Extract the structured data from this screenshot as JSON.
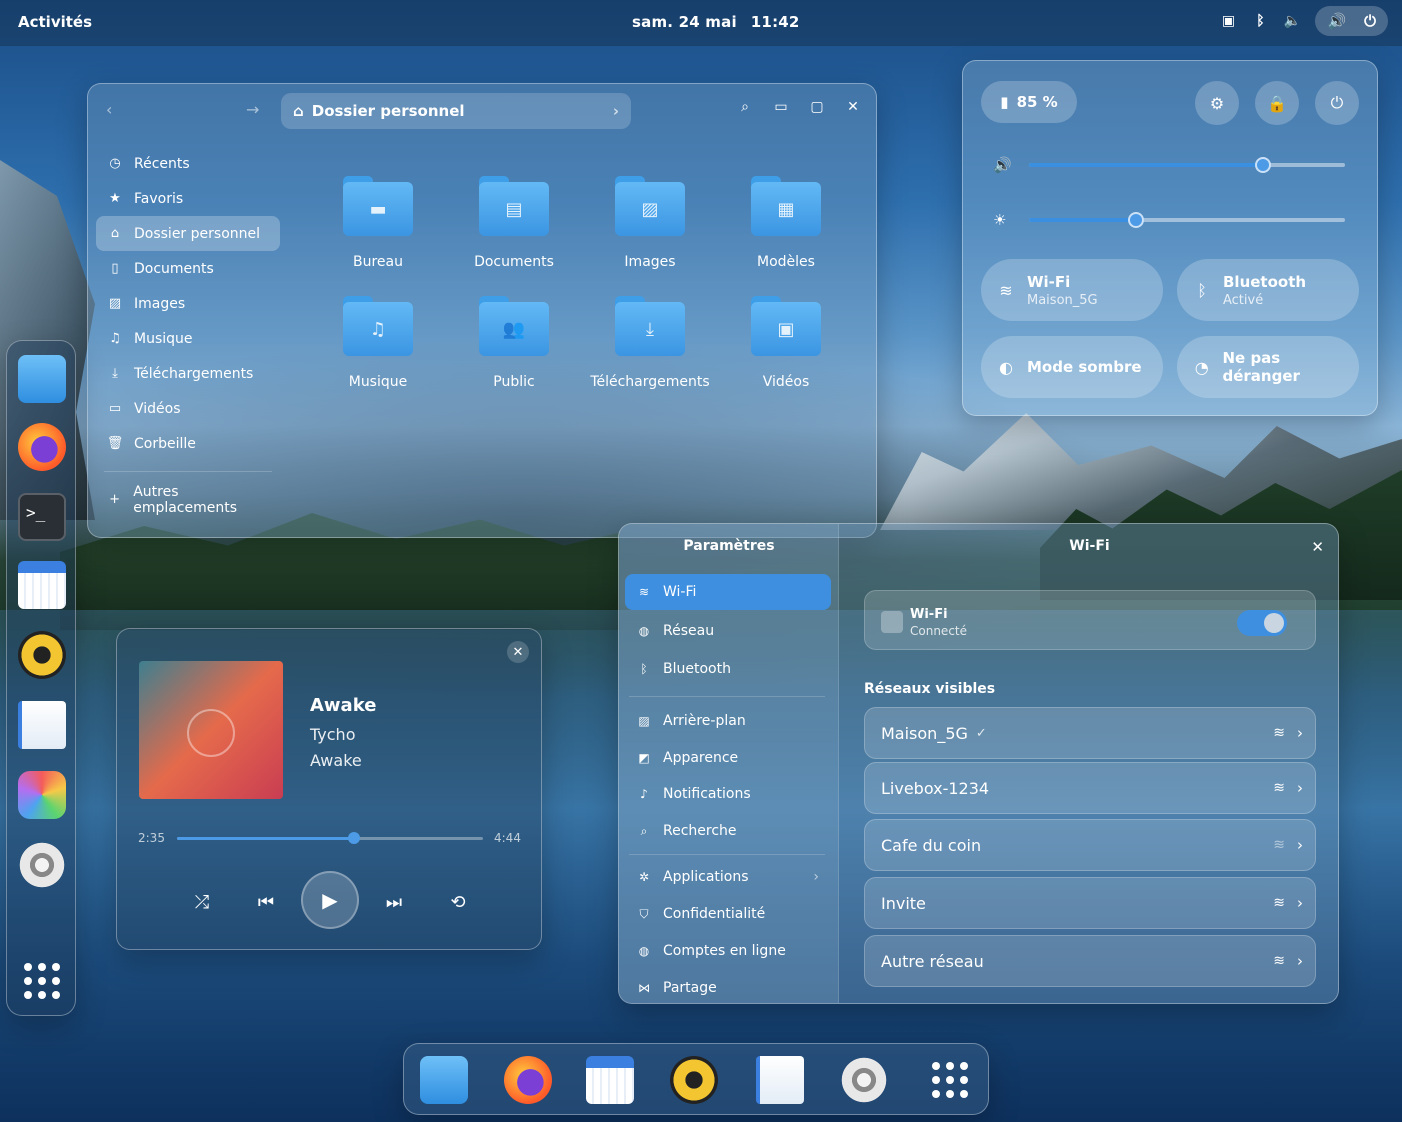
{
  "topbar": {
    "activities": "Activités",
    "date": "sam. 24 mai",
    "time": "11:42"
  },
  "files": {
    "path": "Dossier personnel",
    "sidebar": [
      {
        "label": "Récents",
        "icon": "clock-icon"
      },
      {
        "label": "Favoris",
        "icon": "star-icon"
      },
      {
        "label": "Dossier personnel",
        "icon": "home-icon",
        "active": true
      },
      {
        "label": "Documents",
        "icon": "document-icon"
      },
      {
        "label": "Images",
        "icon": "image-icon"
      },
      {
        "label": "Musique",
        "icon": "music-icon"
      },
      {
        "label": "Téléchargements",
        "icon": "download-icon"
      },
      {
        "label": "Vidéos",
        "icon": "video-icon"
      },
      {
        "label": "Corbeille",
        "icon": "trash-icon"
      }
    ],
    "other_locations": "Autres emplacements",
    "folders": [
      {
        "label": "Bureau",
        "icon": "desktop-folder-icon"
      },
      {
        "label": "Documents",
        "icon": "documents-folder-icon"
      },
      {
        "label": "Images",
        "icon": "pictures-folder-icon"
      },
      {
        "label": "Modèles",
        "icon": "templates-folder-icon"
      },
      {
        "label": "Musique",
        "icon": "music-folder-icon"
      },
      {
        "label": "Public",
        "icon": "public-folder-icon"
      },
      {
        "label": "Téléchargements",
        "icon": "downloads-folder-icon"
      },
      {
        "label": "Vidéos",
        "icon": "videos-folder-icon"
      }
    ]
  },
  "quick_settings": {
    "battery": "85 %",
    "volume_level": 0.74,
    "brightness_level": 0.34,
    "tiles": [
      {
        "title": "Wi-Fi",
        "subtitle": "Maison_5G",
        "icon": "wifi-icon"
      },
      {
        "title": "Bluetooth",
        "subtitle": "Activé",
        "icon": "bluetooth-icon"
      },
      {
        "title": "Mode sombre",
        "subtitle": "",
        "icon": "dark-mode-icon"
      },
      {
        "title": "Ne pas déranger",
        "subtitle": "",
        "icon": "do-not-disturb-icon"
      }
    ]
  },
  "music": {
    "title": "Awake",
    "artist": "Tycho",
    "album": "Awake",
    "elapsed": "2:35",
    "duration": "4:44",
    "progress": 0.58
  },
  "settings": {
    "sidebar_title": "Paramètres",
    "page_title": "Wi-Fi",
    "sidebar": [
      {
        "label": "Wi-Fi",
        "icon": "wifi-icon",
        "active": true
      },
      {
        "label": "Réseau",
        "icon": "globe-icon"
      },
      {
        "label": "Bluetooth",
        "icon": "bluetooth-icon"
      },
      {
        "label": "Arrière-plan",
        "icon": "wallpaper-icon"
      },
      {
        "label": "Apparence",
        "icon": "appearance-icon"
      },
      {
        "label": "Notifications",
        "icon": "bell-icon"
      },
      {
        "label": "Recherche",
        "icon": "search-icon"
      },
      {
        "label": "Applications",
        "icon": "apps-icon",
        "has_arrow": true
      },
      {
        "label": "Confidentialité",
        "icon": "privacy-icon"
      },
      {
        "label": "Comptes en ligne",
        "icon": "accounts-icon"
      },
      {
        "label": "Partage",
        "icon": "share-icon"
      }
    ],
    "wifi_card": {
      "title": "Wi-Fi",
      "status": "Connecté",
      "enabled": true
    },
    "visible_networks_title": "Réseaux visibles",
    "networks": [
      {
        "name": "Maison_5G",
        "connected": true,
        "strong": true
      },
      {
        "name": "Livebox-1234",
        "connected": false,
        "strong": true
      },
      {
        "name": "Cafe du coin",
        "connected": false,
        "strong": false
      },
      {
        "name": "Invite",
        "connected": false,
        "strong": true
      },
      {
        "name": "Autre réseau",
        "connected": false,
        "strong": true
      }
    ]
  },
  "dock_left": [
    "files",
    "firefox",
    "terminal",
    "calendar",
    "rhythmbox",
    "text-editor",
    "photos",
    "settings",
    "app-grid"
  ],
  "dock_bottom": [
    "files",
    "firefox",
    "calendar",
    "rhythmbox",
    "text-editor",
    "settings",
    "app-grid"
  ]
}
